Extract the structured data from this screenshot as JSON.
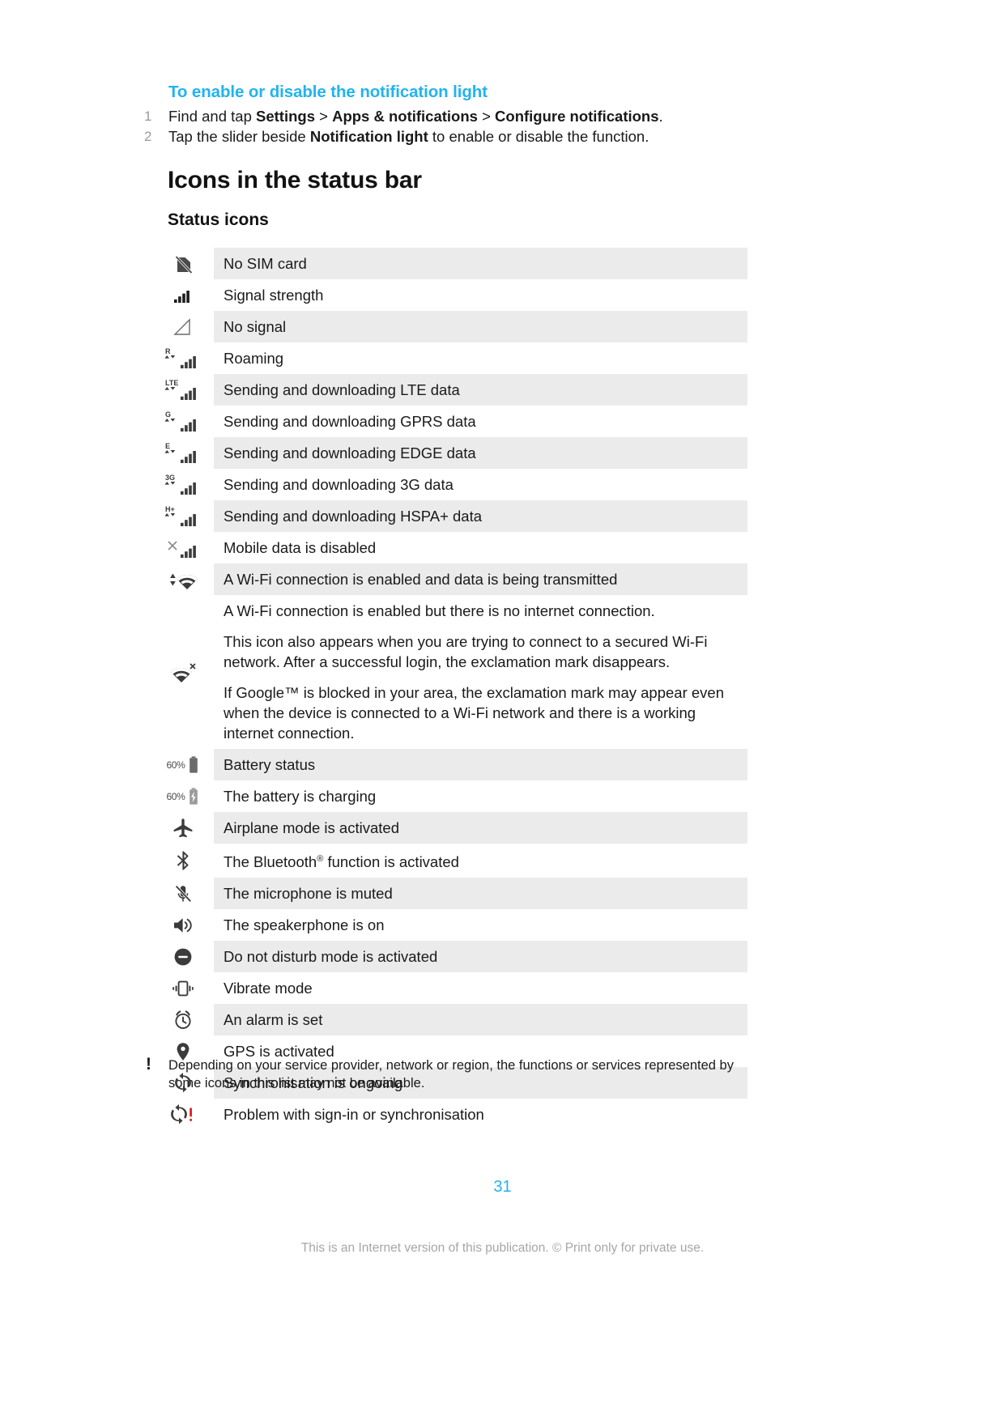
{
  "procedure": {
    "title": "To enable or disable the notification light",
    "steps": [
      {
        "num": "1",
        "parts": [
          {
            "t": "Find and tap ",
            "b": false
          },
          {
            "t": "Settings",
            "b": true
          },
          {
            "t": " > ",
            "b": false
          },
          {
            "t": "Apps & notifications",
            "b": true
          },
          {
            "t": " > ",
            "b": false
          },
          {
            "t": "Configure notifications",
            "b": true
          },
          {
            "t": ".",
            "b": false
          }
        ]
      },
      {
        "num": "2",
        "parts": [
          {
            "t": "Tap the slider beside ",
            "b": false
          },
          {
            "t": "Notification light",
            "b": true
          },
          {
            "t": " to enable or disable the function.",
            "b": false
          }
        ]
      }
    ]
  },
  "headings": {
    "h1": "Icons in the status bar",
    "h2": "Status icons"
  },
  "table": {
    "rows": [
      {
        "icon": "no-sim-card-icon",
        "label": "No SIM card",
        "shaded": true
      },
      {
        "icon": "signal-strength-icon",
        "label": "Signal strength",
        "shaded": false
      },
      {
        "icon": "no-signal-icon",
        "label": "No signal",
        "shaded": true
      },
      {
        "icon": "roaming-icon",
        "label": "Roaming",
        "shaded": false,
        "badge": "R"
      },
      {
        "icon": "lte-data-icon",
        "label": "Sending and downloading LTE data",
        "shaded": true,
        "badge": "LTE"
      },
      {
        "icon": "gprs-data-icon",
        "label": "Sending and downloading GPRS data",
        "shaded": false,
        "badge": "G"
      },
      {
        "icon": "edge-data-icon",
        "label": "Sending and downloading EDGE data",
        "shaded": true,
        "badge": "E"
      },
      {
        "icon": "three-g-data-icon",
        "label": "Sending and downloading 3G data",
        "shaded": false,
        "badge": "3G"
      },
      {
        "icon": "hspa-plus-data-icon",
        "label": "Sending and downloading HSPA+ data",
        "shaded": true,
        "badge": "H+"
      },
      {
        "icon": "mobile-data-disabled-icon",
        "label": "Mobile data is disabled",
        "shaded": false
      },
      {
        "icon": "wifi-transmitting-icon",
        "label": "A Wi-Fi connection is enabled and data is being transmitted",
        "shaded": true
      },
      {
        "icon": "wifi-no-internet-icon",
        "label": "A Wi-Fi connection is enabled but there is no internet connection.",
        "shaded": false,
        "paragraphs": [
          "This icon also appears when you are trying to connect to a secured Wi-Fi network. After a successful login, the exclamation mark disappears.",
          "If Google™ is blocked in your area, the exclamation mark may appear even when the device is connected to a Wi-Fi network and there is a working internet connection."
        ]
      },
      {
        "icon": "battery-status-icon",
        "label": "Battery status",
        "shaded": true,
        "battery_pct": "60%"
      },
      {
        "icon": "battery-charging-icon",
        "label": "The battery is charging",
        "shaded": false,
        "battery_pct": "60%"
      },
      {
        "icon": "airplane-mode-icon",
        "label": "Airplane mode is activated",
        "shaded": true
      },
      {
        "icon": "bluetooth-icon",
        "label_html": "The Bluetooth<sup>®</sup> function is activated",
        "label": "The Bluetooth® function is activated",
        "shaded": false
      },
      {
        "icon": "microphone-muted-icon",
        "label": "The microphone is muted",
        "shaded": true
      },
      {
        "icon": "speakerphone-icon",
        "label": "The speakerphone is on",
        "shaded": false
      },
      {
        "icon": "do-not-disturb-icon",
        "label": "Do not disturb mode is activated",
        "shaded": true
      },
      {
        "icon": "vibrate-mode-icon",
        "label": "Vibrate mode",
        "shaded": false
      },
      {
        "icon": "alarm-icon",
        "label": "An alarm is set",
        "shaded": true
      },
      {
        "icon": "gps-icon",
        "label": "GPS is activated",
        "shaded": false
      },
      {
        "icon": "sync-ongoing-icon",
        "label": "Synchronisation is ongoing",
        "shaded": true
      },
      {
        "icon": "sync-problem-icon",
        "label": "Problem with sign-in or synchronisation",
        "shaded": false
      }
    ]
  },
  "note": {
    "marker": "!",
    "text": "Depending on your service provider, network or region, the functions or services represented by some icons in this list may not be available."
  },
  "footer": {
    "page_number": "31",
    "imprint": "This is an Internet version of this publication. © Print only for private use."
  },
  "colors": {
    "accent": "#21b3f0",
    "row_shade": "#ebebeb",
    "text": "#1a1a1a",
    "icon_dark": "#3b3b3b",
    "alert_red": "#e02020"
  }
}
